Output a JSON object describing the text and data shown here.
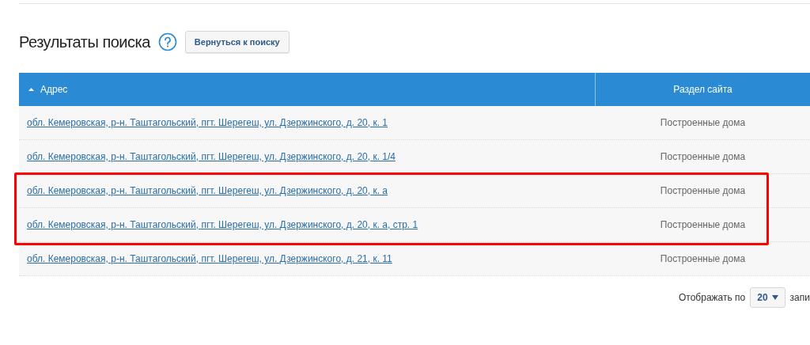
{
  "title": "Результаты поиска",
  "back_button": "Вернуться к поиску",
  "table": {
    "columns": [
      {
        "label": "Адрес",
        "sorted": true
      },
      {
        "label": "Раздел сайта",
        "sorted": false
      }
    ],
    "rows": [
      {
        "address": "обл. Кемеровская, р-н. Таштагольский, пгт. Шерегеш, ул. Дзержинского, д. 20, к. 1",
        "section": "Построенные дома",
        "highlighted": false
      },
      {
        "address": "обл. Кемеровская, р-н. Таштагольский, пгт. Шерегеш, ул. Дзержинского, д. 20, к. 1/4",
        "section": "Построенные дома",
        "highlighted": false
      },
      {
        "address": "обл. Кемеровская, р-н. Таштагольский, пгт. Шерегеш, ул. Дзержинского, д. 20, к. а",
        "section": "Построенные дома",
        "highlighted": true
      },
      {
        "address": "обл. Кемеровская, р-н. Таштагольский, пгт. Шерегеш, ул. Дзержинского, д. 20, к. а, стр. 1",
        "section": "Построенные дома",
        "highlighted": true
      },
      {
        "address": "обл. Кемеровская, р-н. Таштагольский, пгт. Шерегеш, ул. Дзержинского, д. 21, к. 11",
        "section": "Построенные дома",
        "highlighted": false
      }
    ]
  },
  "pager": {
    "label": "Отображать по",
    "value": "20",
    "suffix": "запи"
  }
}
